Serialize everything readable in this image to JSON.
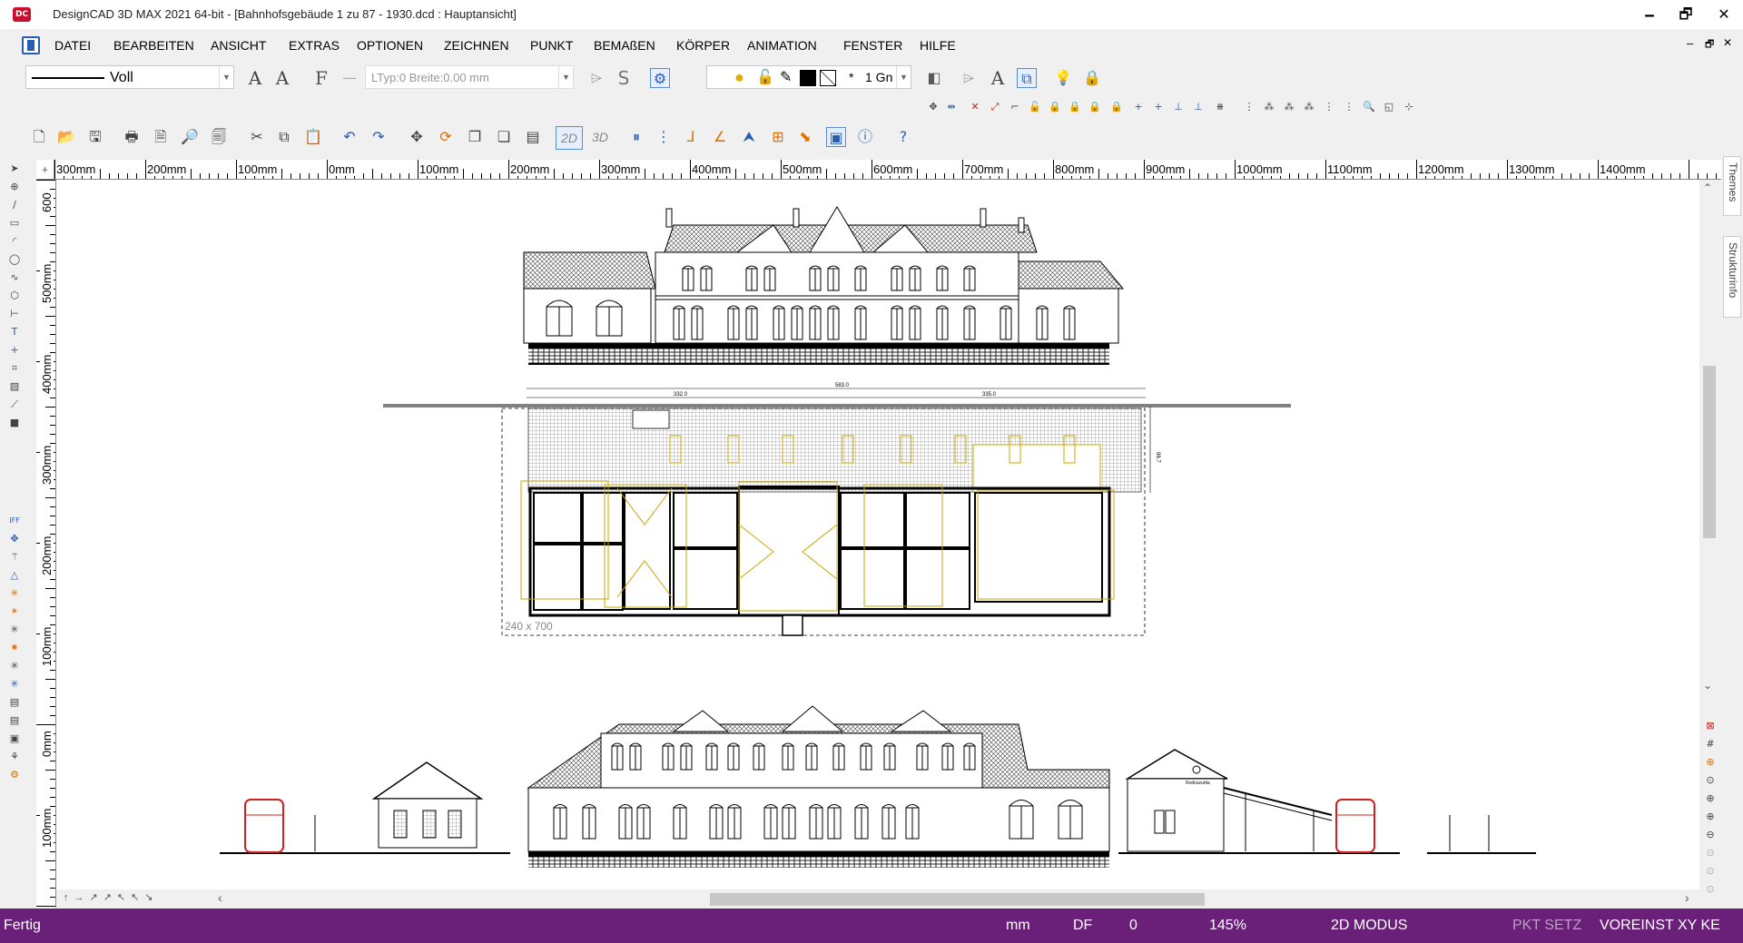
{
  "window": {
    "logo": "DC",
    "title": "DesignCAD 3D MAX 2021 64-bit - [Bahnhofsgebäude 1 zu 87 - 1930.dcd : Hauptansicht]",
    "minimize_glyph": "🗕",
    "restore_glyph": "🗗",
    "close_glyph": "✕",
    "mdi_minimize_glyph": "–",
    "mdi_restore_glyph": "🗗",
    "mdi_close_glyph": "✕"
  },
  "menu": {
    "icon": "document-icon",
    "items": [
      "DATEI",
      "BEARBEITEN",
      "ANSICHT",
      "EXTRAS",
      "OPTIONEN",
      "ZEICHNEN",
      "PUNKT",
      "BEMAßEN",
      "KÖRPER",
      "ANIMATION",
      "FENSTER",
      "HILFE"
    ]
  },
  "toolbar1": {
    "line_style_value": "Voll",
    "line_type_value": "LTyp:0  Breite:0.00 mm",
    "font_glyphs": [
      "A",
      "A",
      "F"
    ],
    "layer_count_prefix": "*",
    "layer_value": "1 Gn"
  },
  "toolbar3": {
    "mode_2d": "2D",
    "mode_3d": "3D"
  },
  "ruler_top": {
    "labels": [
      "300mm",
      "200mm",
      "100mm",
      "0mm",
      "100mm",
      "200mm",
      "300mm",
      "400mm",
      "500mm",
      "600mm",
      "700mm",
      "800mm",
      "900mm",
      "1000mm",
      "1100mm",
      "1200mm",
      "1300mm",
      "1400mm"
    ]
  },
  "ruler_left": {
    "labels": [
      "600",
      "500mm",
      "400mm",
      "300mm",
      "200mm",
      "100mm",
      "0mm",
      "100mm"
    ]
  },
  "canvas": {
    "scale_hint": "240 x 700",
    "dim_total": "583.0",
    "dim_left": "332.0",
    "dim_right": "335.0",
    "dim_side": "98.7",
    "sign_text": "Rodoszurtia",
    "colors": {
      "line": "#000000",
      "hatch": "#555555",
      "yellow": "#c8a800",
      "red": "#d02020"
    }
  },
  "side_tabs": [
    "Themes",
    "Strukturinfo"
  ],
  "status": {
    "left": "Fertig",
    "unit": "mm",
    "df": "DF",
    "zero": "0",
    "zoom": "145%",
    "mode": "2D MODUS",
    "pkt": "PKT SETZ",
    "voreinst": "VOREINST XY KE",
    "bg_color": "#6a1f78"
  }
}
